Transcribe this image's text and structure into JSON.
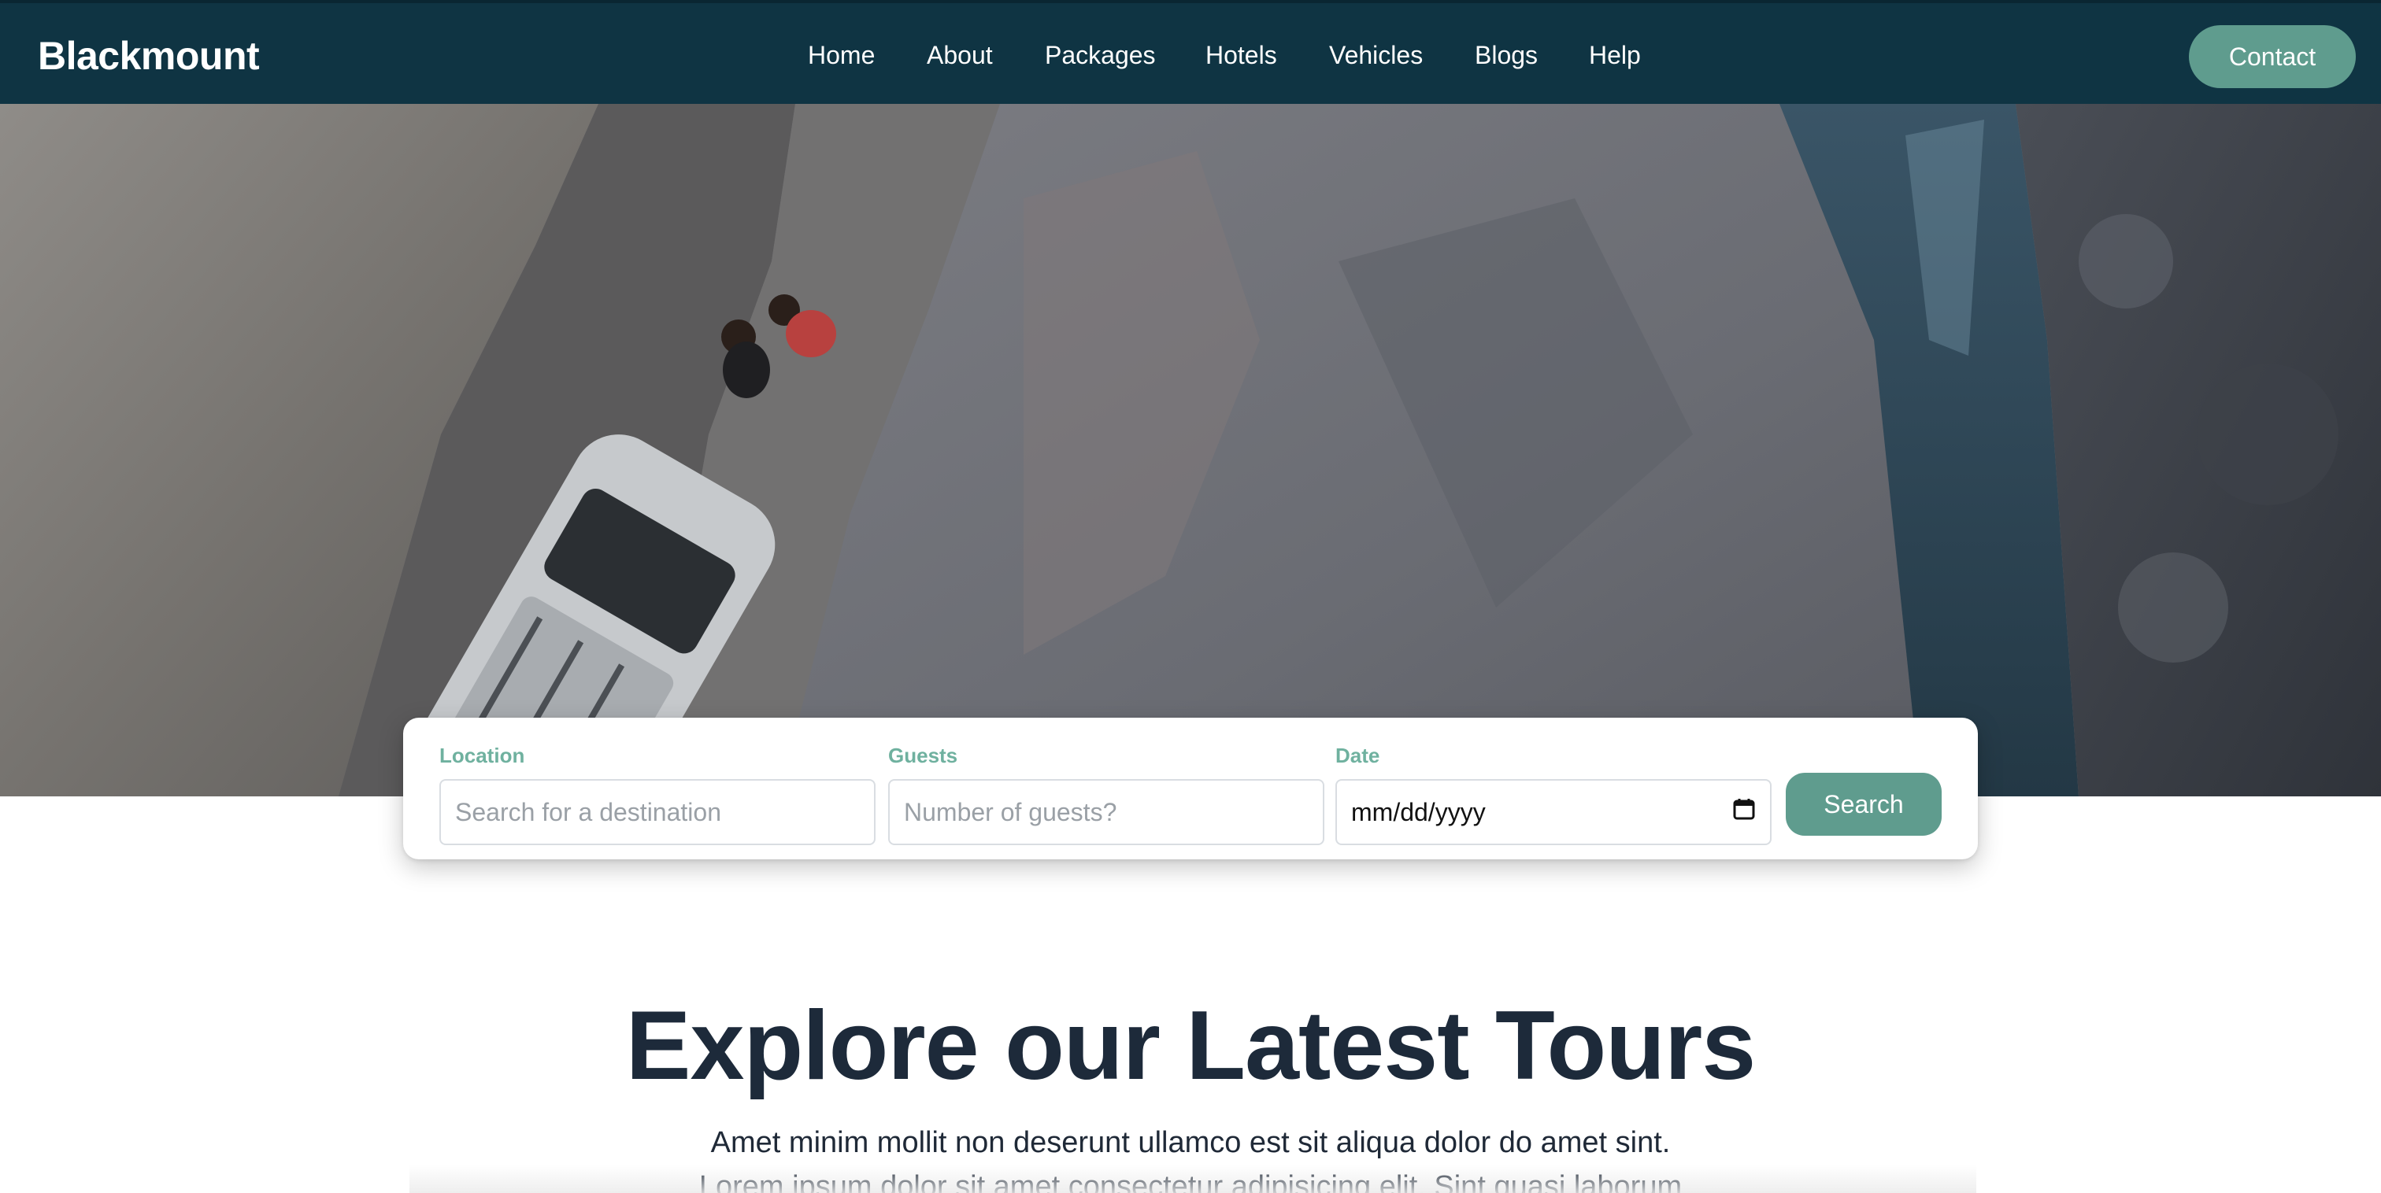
{
  "navbar": {
    "brand": "Blackmount",
    "links": [
      "Home",
      "About",
      "Packages",
      "Hotels",
      "Vehicles",
      "Blogs",
      "Help"
    ],
    "contact_label": "Contact",
    "background": "#0f3443",
    "accent": "#5f9c8e"
  },
  "hero": {
    "image": "aerial-cliff-road-with-vehicle-and-river"
  },
  "search": {
    "location": {
      "label": "Location",
      "placeholder": "Search for a destination"
    },
    "guests": {
      "label": "Guests",
      "placeholder": "Number of guests?"
    },
    "date": {
      "label": "Date",
      "value": "mm/dd/yyyy",
      "icon": "calendar-icon"
    },
    "button_label": "Search",
    "label_color": "#6fb19f"
  },
  "section": {
    "title": "Explore our Latest Tours",
    "line1": "Amet minim mollit non deserunt ullamco est sit aliqua dolor do amet sint.",
    "line2": "Lorem ipsum dolor sit amet consectetur adipisicing elit. Sint quasi laborum"
  }
}
